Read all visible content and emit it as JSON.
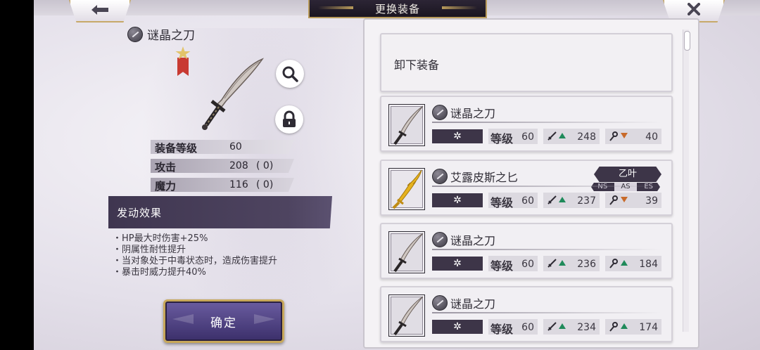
{
  "header": {
    "title": "更换装备",
    "back_icon": "arrow-left-icon",
    "close_icon": "close-x-icon"
  },
  "detail": {
    "name": "谜晶之刀",
    "stats": [
      {
        "label": "装备等级",
        "value": "60",
        "bonus": ""
      },
      {
        "label": "攻击",
        "value": "208",
        "bonus": "(    0)"
      },
      {
        "label": "魔力",
        "value": "116",
        "bonus": "(    0)"
      }
    ],
    "effect_title": "发动效果",
    "effects": [
      "HP最大时伤害+25%",
      "阴属性耐性提升",
      "当对象处于中毒状态时，造成伤害提升",
      "暴击时威力提升40%"
    ],
    "confirm_label": "确定"
  },
  "list": {
    "unequip_label": "卸下装备",
    "items": [
      {
        "name": "谜晶之刀",
        "rank": "✲",
        "level_label": "等级",
        "level": "60",
        "attack": "248",
        "attack_trend": "up",
        "magic": "40",
        "magic_trend": "down",
        "gold": false
      },
      {
        "name": "艾露皮斯之匕",
        "rank": "✲",
        "level_label": "等级",
        "level": "60",
        "attack": "237",
        "attack_trend": "up",
        "magic": "39",
        "magic_trend": "down",
        "gold": true,
        "owner": "乙叶",
        "rank_tabs": [
          "NS",
          "AS",
          "ES"
        ],
        "rank_tab_active": "AS"
      },
      {
        "name": "谜晶之刀",
        "rank": "✲",
        "level_label": "等级",
        "level": "60",
        "attack": "236",
        "attack_trend": "up",
        "magic": "184",
        "magic_trend": "up",
        "gold": false
      },
      {
        "name": "谜晶之刀",
        "rank": "✲",
        "level_label": "等级",
        "level": "60",
        "attack": "234",
        "attack_trend": "up",
        "magic": "174",
        "magic_trend": "up",
        "gold": false
      }
    ]
  },
  "colors": {
    "accent_gold": "#c8a85a",
    "panel_dark": "#3d3548",
    "up_arrow": "#1f8a5a",
    "down_arrow": "#c86a2a"
  }
}
